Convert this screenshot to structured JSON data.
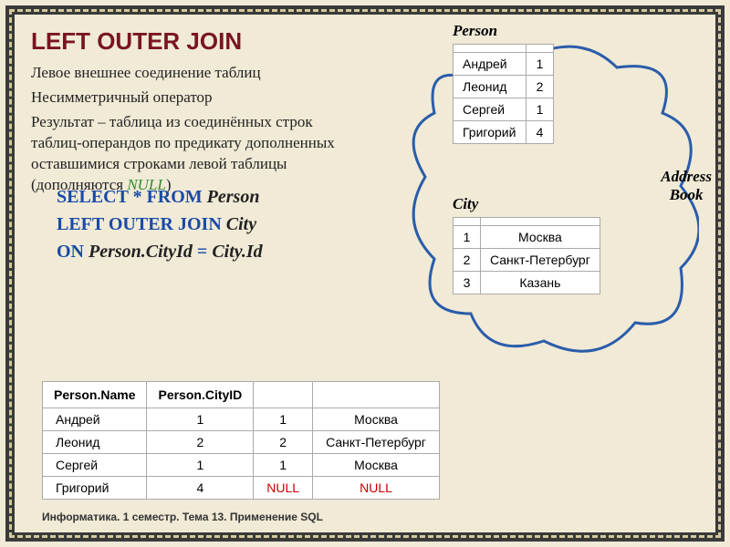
{
  "title": "LEFT OUTER  JOIN",
  "desc": {
    "p1": "Левое внешнее соединение таблиц",
    "p2": "Несимметричный оператор",
    "p3a": "Результат – таблица из соединённых строк таблиц-операндов по предикату дополненных оставшимися строками левой таблицы (дополняются ",
    "p3b": "NULL",
    "p3c": ")"
  },
  "sql": {
    "l1a": "SELECT * FROM ",
    "l1b": "Person",
    "l2a": "LEFT OUTER JOIN ",
    "l2b": "City",
    "l3a": "ON ",
    "l3b": "Person.CityId ",
    "l3c": "= ",
    "l3d": "City.Id"
  },
  "labels": {
    "person": "Person",
    "city": "City",
    "ab1": "Address",
    "ab2": "Book"
  },
  "person": [
    {
      "name": "Андрей",
      "cid": "1"
    },
    {
      "name": "Леонид",
      "cid": "2"
    },
    {
      "name": "Сергей",
      "cid": "1"
    },
    {
      "name": "Григорий",
      "cid": "4"
    }
  ],
  "city": [
    {
      "id": "1",
      "name": "Москва"
    },
    {
      "id": "2",
      "name": "Санкт-Петербург"
    },
    {
      "id": "3",
      "name": "Казань"
    }
  ],
  "result": {
    "h1": "Person.Name",
    "h2": "Person.CityID",
    "h3": "",
    "h4": "",
    "rows": [
      {
        "c1": "Андрей",
        "c2": "1",
        "c3": "1",
        "c4": "Москва",
        "null": false
      },
      {
        "c1": "Леонид",
        "c2": "2",
        "c3": "2",
        "c4": "Санкт-Петербург",
        "null": false
      },
      {
        "c1": "Сергей",
        "c2": "1",
        "c3": "1",
        "c4": "Москва",
        "null": false
      },
      {
        "c1": "Григорий",
        "c2": "4",
        "c3": "NULL",
        "c4": "NULL",
        "null": true
      }
    ]
  },
  "footer": "Информатика. 1 семестр. Тема 13. Применение SQL"
}
